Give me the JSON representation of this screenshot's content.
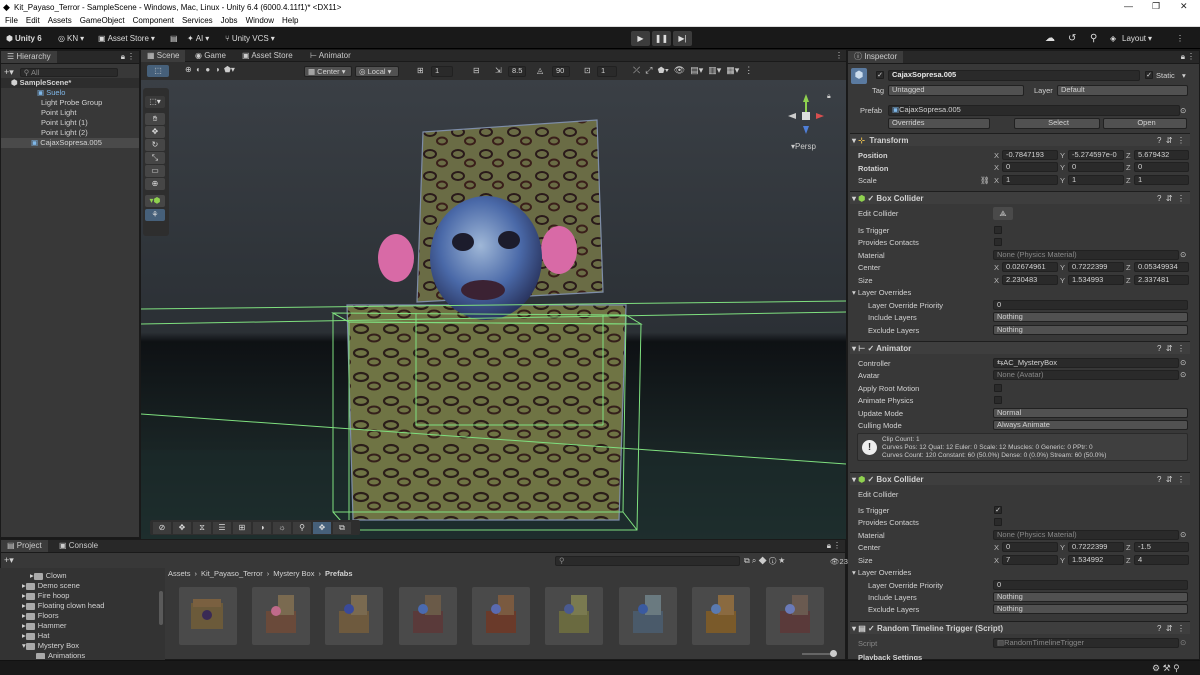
{
  "window": {
    "title": "Kit_Payaso_Terror - SampleScene - Windows, Mac, Linux - Unity 6.4 (6000.4.11f1)* <DX11>",
    "minimize": "—",
    "maximize": "❐",
    "close": "✕"
  },
  "menu": [
    "File",
    "Edit",
    "Assets",
    "GameObject",
    "Component",
    "Services",
    "Jobs",
    "Window",
    "Help"
  ],
  "toolbar": {
    "unity": "Unity 6",
    "account": "KN",
    "asset_store": "Asset Store",
    "ai": "AI",
    "vcs": "Unity VCS",
    "layout": "Layout"
  },
  "hierarchy": {
    "tab": "Hierarchy",
    "search": "All",
    "items": [
      "SampleScene*",
      "Suelo",
      "Light Probe Group",
      "Point Light",
      "Point Light (1)",
      "Point Light (2)",
      "CajaxSopresa.005"
    ]
  },
  "scene_tabs": [
    "Scene",
    "Game",
    "Asset Store",
    "Animator"
  ],
  "scene_toolbar": {
    "pivot": "Center",
    "space": "Local",
    "grid": "1",
    "snap": "8.5",
    "angle": "90",
    "scale": "1"
  },
  "gizmo": {
    "persp": "Persp"
  },
  "inspector": {
    "tab": "Inspector",
    "object_name": "CajaxSopresa.005",
    "static": "Static",
    "tag_label": "Tag",
    "tag": "Untagged",
    "layer_label": "Layer",
    "layer": "Default",
    "prefab_label": "Prefab",
    "prefab": "CajaxSopresa.005",
    "overrides": "Overrides",
    "select": "Select",
    "open": "Open",
    "transform": {
      "title": "Transform",
      "position_label": "Position",
      "rotation_label": "Rotation",
      "scale_label": "Scale",
      "position": [
        "-0.7847193",
        "-5.274597e-0",
        "5.679432"
      ],
      "rotation": [
        "0",
        "0",
        "0"
      ],
      "scale": [
        "1",
        "1",
        "1"
      ]
    },
    "box1": {
      "title": "Box Collider",
      "edit": "Edit Collider",
      "is_trigger": "Is Trigger",
      "provides": "Provides Contacts",
      "material_label": "Material",
      "material": "None (Physics Material)",
      "center_label": "Center",
      "center": [
        "0.02674961",
        "0.7222399",
        "0.05349934"
      ],
      "size_label": "Size",
      "size": [
        "2.230483",
        "1.534993",
        "2.337481"
      ],
      "layer_overrides": "Layer Overrides",
      "priority_label": "Layer Override Priority",
      "priority": "0",
      "include_label": "Include Layers",
      "include": "Nothing",
      "exclude_label": "Exclude Layers",
      "exclude": "Nothing"
    },
    "animator": {
      "title": "Animator",
      "controller_label": "Controller",
      "controller": "AC_MysteryBox",
      "avatar_label": "Avatar",
      "avatar": "None (Avatar)",
      "root_motion": "Apply Root Motion",
      "animate_physics": "Animate Physics",
      "update_label": "Update Mode",
      "update": "Normal",
      "culling_label": "Culling Mode",
      "culling": "Always Animate",
      "info": [
        "Clip Count: 1",
        "Curves Pos: 12 Quat: 12 Euler: 0 Scale: 12 Muscles: 0 Generic: 0 PPtr: 0",
        "Curves Count: 120 Constant: 60 (50.0%) Dense: 0 (0.0%) Stream: 60 (50.0%)"
      ]
    },
    "box2": {
      "title": "Box Collider",
      "edit": "Edit Collider",
      "is_trigger": "Is Trigger",
      "provides": "Provides Contacts",
      "material_label": "Material",
      "material": "None (Physics Material)",
      "center_label": "Center",
      "center": [
        "0",
        "0.7222399",
        "-1.5"
      ],
      "size_label": "Size",
      "size": [
        "7",
        "1.534992",
        "4"
      ],
      "layer_overrides": "Layer Overrides",
      "priority_label": "Layer Override Priority",
      "priority": "0",
      "include_label": "Include Layers",
      "include": "Nothing",
      "exclude_label": "Exclude Layers",
      "exclude": "Nothing"
    },
    "script": {
      "title": "Random Timeline Trigger (Script)",
      "script_label": "Script",
      "script": "RandomTimelineTrigger",
      "next": "Playback Settings"
    }
  },
  "project": {
    "tab_project": "Project",
    "tab_console": "Console",
    "folders": [
      "Clown",
      "Demo scene",
      "Fire hoop",
      "Floating clown head",
      "Floors",
      "Hammer",
      "Hat",
      "Mystery Box",
      "Animations"
    ],
    "breadcrumb": [
      "Assets",
      "Kit_Payaso_Terror",
      "Mystery Box",
      "Prefabs"
    ],
    "count": "23"
  },
  "colors": {
    "accent": "#2c5d87",
    "blue_text": "#7fb7e8",
    "collider": "#7fe07f"
  }
}
